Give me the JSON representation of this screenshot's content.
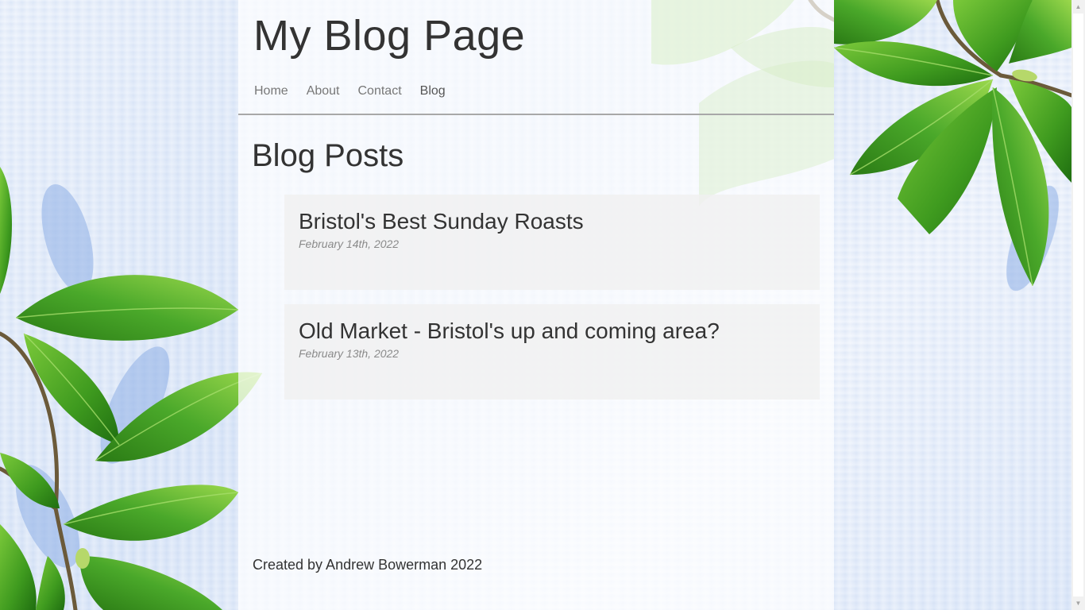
{
  "header": {
    "title": "My Blog Page",
    "nav": [
      {
        "label": "Home"
      },
      {
        "label": "About"
      },
      {
        "label": "Contact"
      },
      {
        "label": "Blog"
      }
    ]
  },
  "main": {
    "section_title": "Blog Posts",
    "posts": [
      {
        "title": "Bristol's Best Sunday Roasts",
        "date": "February 14th, 2022"
      },
      {
        "title": "Old Market - Bristol's up and coming area?",
        "date": "February 13th, 2022"
      }
    ]
  },
  "footer": {
    "text": "Created by Andrew Bowerman 2022"
  },
  "colors": {
    "leaf": "#3f9b1f",
    "fabric": "#dfe9f8",
    "text": "#333333"
  }
}
